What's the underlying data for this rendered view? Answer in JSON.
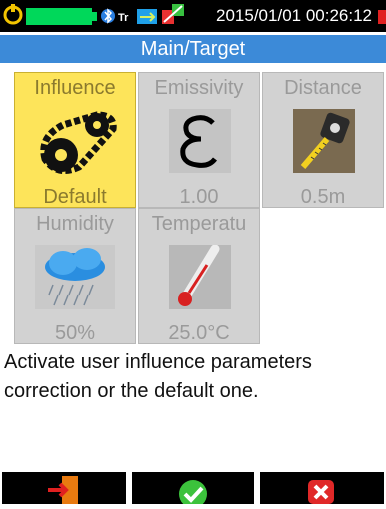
{
  "status": {
    "datetime": "2015/01/01 00:26:12",
    "icons": [
      "power-plug-icon",
      "battery-icon",
      "bluetooth-icon",
      "tr-indicator-icon",
      "usb-icon",
      "thermometer-alert-icon",
      "recording-icon"
    ],
    "battery_color": "#00d85a"
  },
  "title": "Main/Target",
  "accent_color": "#3c8ad8",
  "tiles": [
    {
      "label": "Influence",
      "value": "Default",
      "icon": "gears-chain-icon",
      "selected": true
    },
    {
      "label": "Emissivity",
      "value": "1.00",
      "icon": "epsilon-icon",
      "selected": false
    },
    {
      "label": "Distance",
      "value": "0.5m",
      "icon": "tape-measure-icon",
      "selected": false
    },
    {
      "label": "Humidity",
      "value": "50%",
      "icon": "rain-cloud-icon",
      "selected": false
    },
    {
      "label": "Temperatu",
      "value": "25.0°C",
      "icon": "thermometer-icon",
      "selected": false
    }
  ],
  "description": "Activate user influence parameters correction or the default one.",
  "softkeys": [
    {
      "icon": "exit-door-icon"
    },
    {
      "icon": "confirm-check-icon"
    },
    {
      "icon": "cancel-x-icon"
    }
  ]
}
